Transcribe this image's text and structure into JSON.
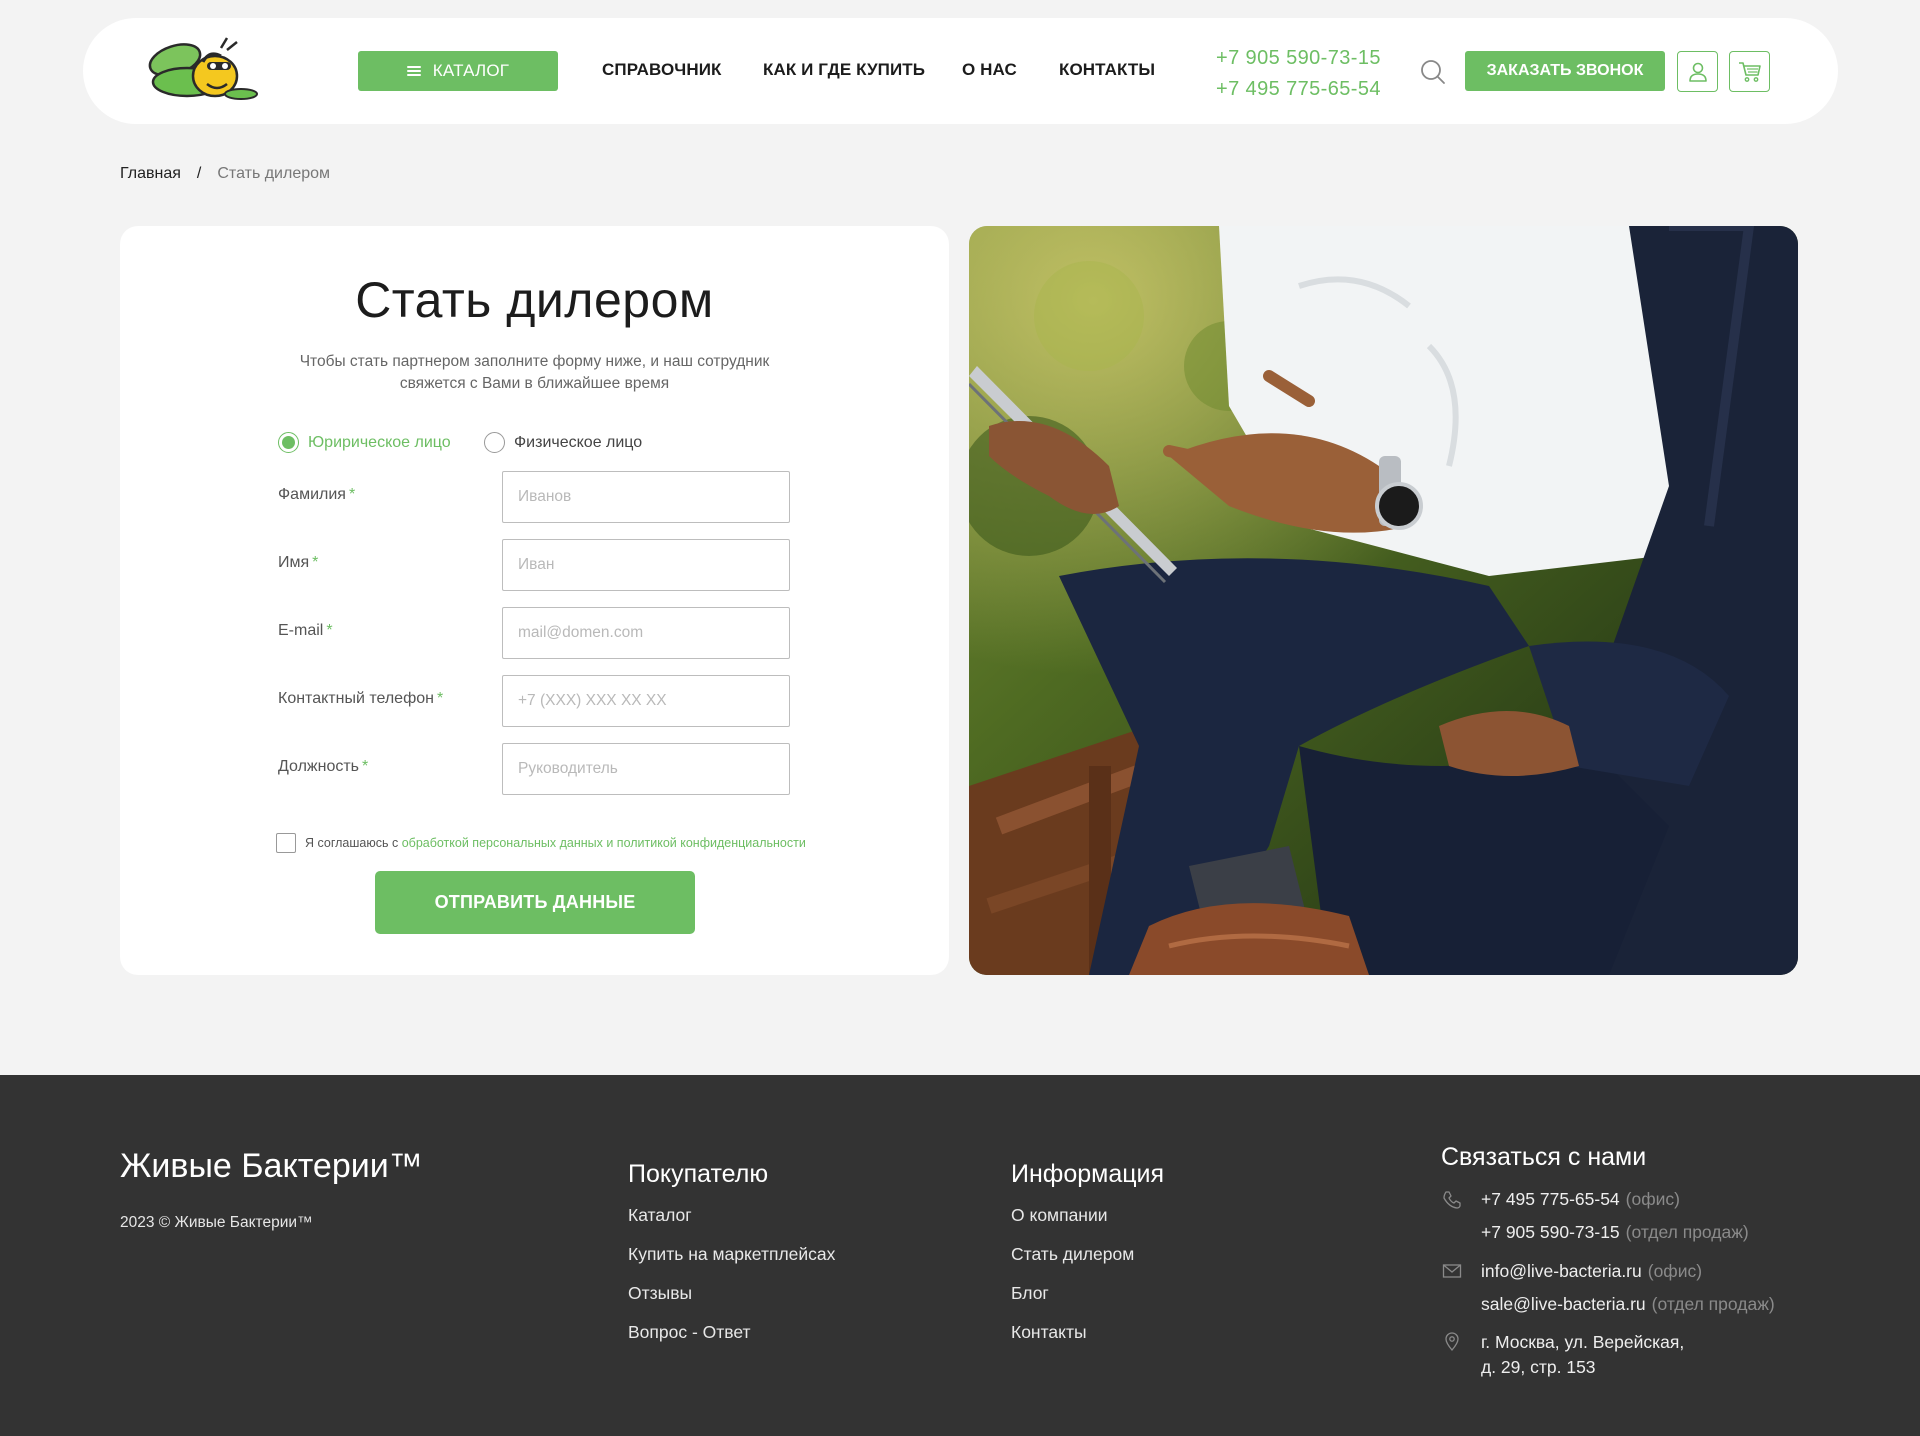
{
  "header": {
    "logo_alt": "Живые Бактерии",
    "catalog_label": "КАТАЛОГ",
    "nav": [
      "СПРАВОЧНИК",
      "КАК И ГДЕ КУПИТЬ",
      "О НАС",
      "КОНТАКТЫ"
    ],
    "phones": [
      "+7 905 590-73-15",
      "+7 495 775-65-54"
    ],
    "callback_label": "ЗАКАЗАТЬ ЗВОНОК"
  },
  "breadcrumb": {
    "home": "Главная",
    "separator": "/",
    "current": "Стать дилером"
  },
  "form": {
    "title": "Стать дилером",
    "subtitle": "Чтобы стать партнером заполните форму ниже, и наш сотрудник свяжется с Вами в ближайшее время",
    "radio_legal": "Юририческое лицо",
    "radio_individual": "Физическое лицо",
    "selected": "legal",
    "fields": [
      {
        "label": "Фамилия",
        "placeholder": "Иванов",
        "value": ""
      },
      {
        "label": "Имя",
        "placeholder": "Иван",
        "value": ""
      },
      {
        "label": "E-mail",
        "placeholder": "mail@domen.com",
        "value": ""
      },
      {
        "label": "Контактный телефон",
        "placeholder": "+7 (XXX) XXX XX XX",
        "value": ""
      },
      {
        "label": "Должность",
        "placeholder": "Руководитель",
        "value": ""
      }
    ],
    "required_mark": "*",
    "consent_text": "Я соглашаюсь с",
    "consent_link": "обработкой персональных данных и политикой конфиденциальности",
    "submit_label": "ОТПРАВИТЬ ДАННЫЕ"
  },
  "footer": {
    "brand": "Живые Бактерии™",
    "copyright": "2023 © Живые Бактерии™",
    "buyer_title": "Покупателю",
    "buyer_links": [
      "Каталог",
      "Купить на маркетплейсах",
      "Отзывы",
      "Вопрос - Ответ"
    ],
    "info_title": "Информация",
    "info_links": [
      "О компании",
      "Стать дилером",
      "Блог",
      "Контакты"
    ],
    "contact_title": "Связаться с нами",
    "phones": [
      {
        "value": "+7 495 775-65-54",
        "note": "(офис)"
      },
      {
        "value": "+7 905 590-73-15",
        "note": "(отдел продаж)"
      }
    ],
    "emails": [
      {
        "value": "info@live-bacteria.ru",
        "note": "(офис)"
      },
      {
        "value": "sale@live-bacteria.ru",
        "note": "(отдел продаж)"
      }
    ],
    "address_line1": "г. Москва, ул. Верейская,",
    "address_line2": "д. 29, стр. 153"
  },
  "colors": {
    "accent": "#6dbe63",
    "footer_bg": "#333333",
    "page_bg": "#f3f3f3"
  },
  "icons": [
    "menu-icon",
    "search-icon",
    "user-icon",
    "cart-icon",
    "phone-icon",
    "mail-icon",
    "location-icon"
  ]
}
